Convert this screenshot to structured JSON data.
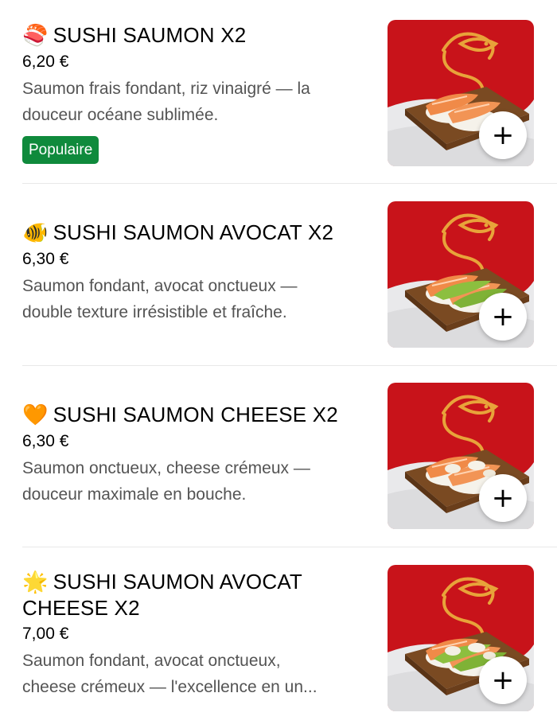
{
  "accent_colors": {
    "badge_green": "#0f8a3c",
    "thumb_red": "#c8131a",
    "thumb_gold": "#e8a33a"
  },
  "items": [
    {
      "emoji": "🍣",
      "emoji_name": "sushi-icon",
      "title": "SUSHI SAUMON X2",
      "price": "6,20 €",
      "desc_line1": "Saumon frais fondant, riz vinaigré — la",
      "desc_line2": "douceur océane sublimée.",
      "badge": "Populaire",
      "add_label": "+",
      "topping": "plain"
    },
    {
      "emoji": "🐠",
      "emoji_name": "tropical-fish-icon",
      "title": "SUSHI SAUMON AVOCAT X2",
      "price": "6,30 €",
      "desc_line1": "Saumon fondant, avocat onctueux —",
      "desc_line2": "double texture irrésistible et fraîche.",
      "add_label": "+",
      "topping": "avocado"
    },
    {
      "emoji": "🧡",
      "emoji_name": "orange-heart-icon",
      "title": "SUSHI SAUMON CHEESE X2",
      "price": "6,30 €",
      "desc_line1": "Saumon onctueux, cheese crémeux —",
      "desc_line2": "douceur maximale en bouche.",
      "add_label": "+",
      "topping": "cheese"
    },
    {
      "emoji": "🌟",
      "emoji_name": "glowing-star-icon",
      "title_line1": "SUSHI SAUMON AVOCAT",
      "title_line2": "CHEESE X2",
      "price": "7,00 €",
      "desc_line1": "Saumon fondant, avocat onctueux,",
      "desc_line2": "cheese crémeux — l'excellence en un...",
      "add_label": "+",
      "topping": "avocado-cheese"
    }
  ]
}
